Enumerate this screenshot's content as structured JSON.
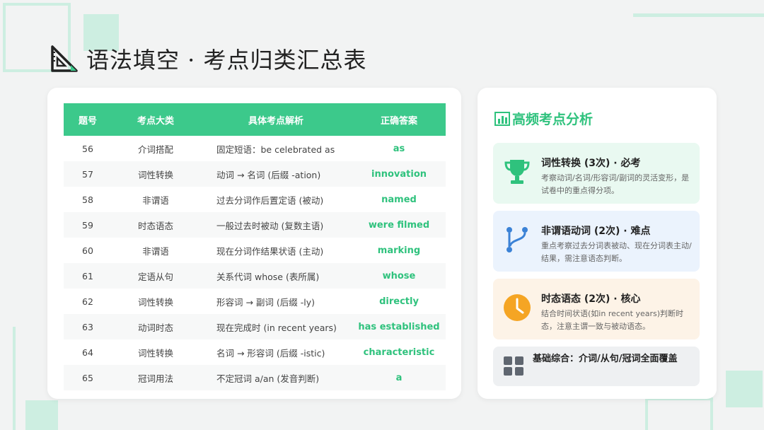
{
  "title": "语法填空 · 考点归类汇总表",
  "table": {
    "headers": [
      "题号",
      "考点大类",
      "具体考点解析",
      "正确答案"
    ],
    "rows": [
      {
        "no": "56",
        "category": "介词搭配",
        "detail": "固定短语：be celebrated as",
        "answer": "as"
      },
      {
        "no": "57",
        "category": "词性转换",
        "detail": "动词 → 名词 (后缀 -ation)",
        "answer": "innovation"
      },
      {
        "no": "58",
        "category": "非谓语",
        "detail": "过去分词作后置定语 (被动)",
        "answer": "named"
      },
      {
        "no": "59",
        "category": "时态语态",
        "detail": "一般过去时被动 (复数主语)",
        "answer": "were filmed"
      },
      {
        "no": "60",
        "category": "非谓语",
        "detail": "现在分词作结果状语 (主动)",
        "answer": "marking"
      },
      {
        "no": "61",
        "category": "定语从句",
        "detail": "关系代词 whose (表所属)",
        "answer": "whose"
      },
      {
        "no": "62",
        "category": "词性转换",
        "detail": "形容词 → 副词 (后缀 -ly)",
        "answer": "directly"
      },
      {
        "no": "63",
        "category": "动词时态",
        "detail": "现在完成时 (in recent years)",
        "answer": "has established"
      },
      {
        "no": "64",
        "category": "词性转换",
        "detail": "名词 → 形容词 (后缀 -istic)",
        "answer": "characteristic"
      },
      {
        "no": "65",
        "category": "冠词用法",
        "detail": "不定冠词 a/an (发音判断)",
        "answer": "a"
      }
    ]
  },
  "analysis": {
    "title": "高频考点分析",
    "items": [
      {
        "title": "词性转换 (3次) · 必考",
        "desc": "考察动词/名词/形容词/副词的灵活变形，是试卷中的重点得分项。",
        "icon": "trophy-icon",
        "color": "#2fc27d"
      },
      {
        "title": "非谓语动词 (2次) · 难点",
        "desc": "重点考察过去分词表被动、现在分词表主动/结果，需注意语态判断。",
        "icon": "branch-icon",
        "color": "#3b82d6"
      },
      {
        "title": "时态语态 (2次) · 核心",
        "desc": "结合时间状语(如in recent years)判断时态，注意主谓一致与被动语态。",
        "icon": "clock-icon",
        "color": "#f5a524"
      }
    ],
    "footer": {
      "title": "基础综合：介词/从句/冠词全面覆盖",
      "icon": "grid-icon",
      "color": "#5f6670"
    }
  },
  "colors": {
    "accent": "#3cc98b",
    "answer": "#2fc27d",
    "decor": "#cdeee1"
  }
}
